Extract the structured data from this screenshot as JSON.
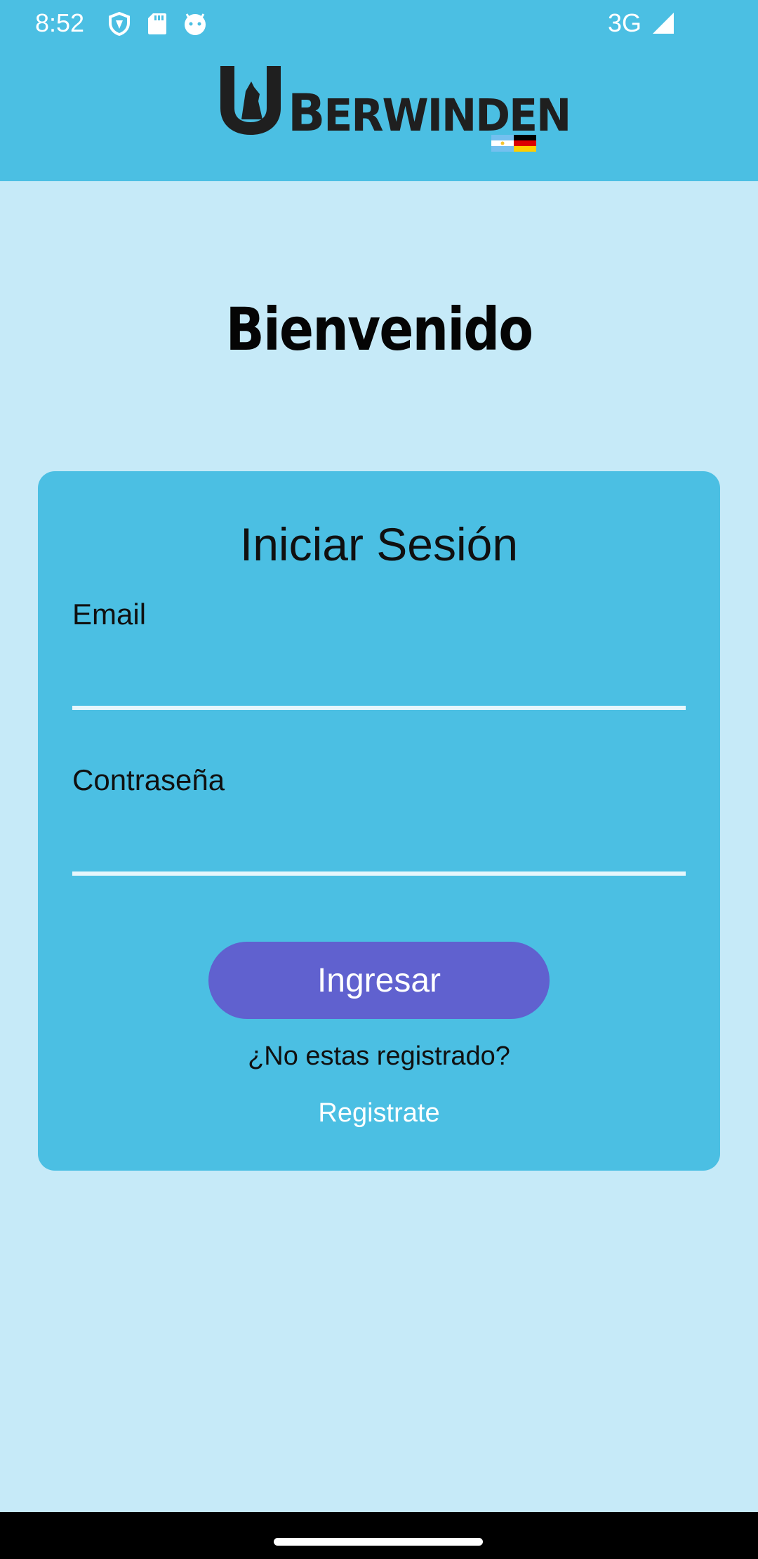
{
  "status_bar": {
    "time": "8:52",
    "network": "3G",
    "icons": [
      "shield-icon",
      "sd-card-icon",
      "android-face-icon",
      "signal-icon"
    ]
  },
  "header": {
    "logo_initial": "B",
    "logo_text": "ERWINDEN",
    "brand_color": "#4bbfe3"
  },
  "welcome": {
    "title": "Bienvenido"
  },
  "login": {
    "title": "Iniciar Sesión",
    "email_label": "Email",
    "email_value": "",
    "password_label": "Contraseña",
    "password_value": "",
    "submit_label": "Ingresar",
    "not_registered_text": "¿No estas registrado?",
    "register_link": "Registrate",
    "card_color": "#4bbfe3",
    "button_color": "#6061cf"
  }
}
